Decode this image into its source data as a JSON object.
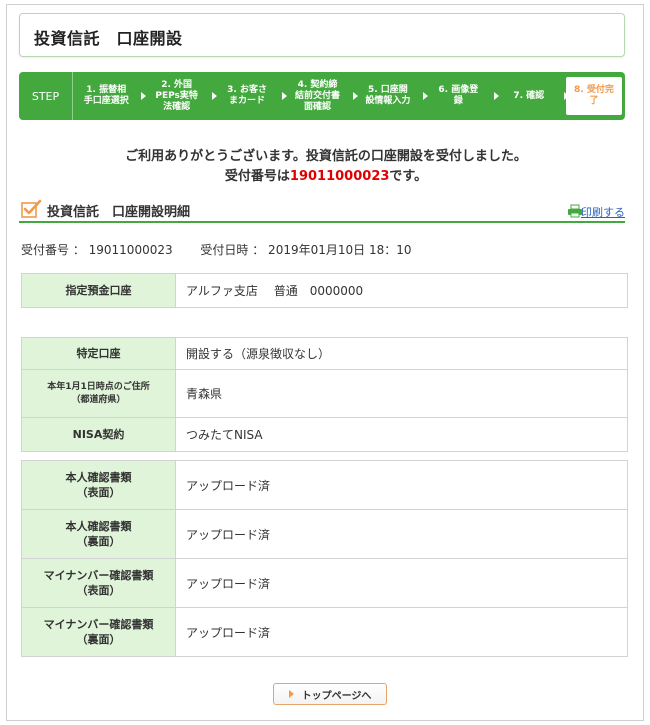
{
  "page_title": "投資信託　口座開設",
  "steps": {
    "head": "STEP",
    "items": [
      {
        "label": "1. 振替相\n手口座選択"
      },
      {
        "label": "2. 外国\nPEPs実特\n法確認"
      },
      {
        "label": "3. お客さ\nまカード"
      },
      {
        "label": "4. 契約締\n結前交付書\n面確認"
      },
      {
        "label": "5. 口座開\n設情報入力"
      },
      {
        "label": "6. 画像登\n録"
      },
      {
        "label": "7. 確認"
      },
      {
        "label": "8. 受付完\n了"
      }
    ]
  },
  "message": {
    "line1": "ご利用ありがとうございます。投資信託の口座開設を受付しました。",
    "line2_prefix": "受付番号は",
    "number": "19011000023",
    "line2_suffix": "です。"
  },
  "section": {
    "title": "投資信託　口座開設明細",
    "print_label": "印刷する"
  },
  "meta": {
    "text": "受付番号 ： 19011000023　　 受付日時 ： 2019年01月10日 18：10"
  },
  "table1": [
    {
      "label": "指定預金口座",
      "value": "アルファ支店　 普通　0000000"
    }
  ],
  "table2": [
    {
      "label": "特定口座",
      "value": "開設する（源泉徴収なし）"
    },
    {
      "label": "本年1月1日時点のご住所\n（都道府県）",
      "value": "青森県"
    },
    {
      "label": "NISA契約",
      "value": "つみたてNISA"
    }
  ],
  "table3": [
    {
      "label": "本人確認書類\n（表面）",
      "value": "アップロード済"
    },
    {
      "label": "本人確認書類\n（裏面）",
      "value": "アップロード済"
    },
    {
      "label": "マイナンバー確認書類\n（表面）",
      "value": "アップロード済"
    },
    {
      "label": "マイナンバー確認書類\n（裏面）",
      "value": "アップロード済"
    }
  ],
  "button": {
    "label": "トップページへ"
  },
  "colors": {
    "accent": "#43a83e",
    "label_bg": "#dff4d9",
    "highlight": "#e00000",
    "active_step": "#f29a49"
  }
}
